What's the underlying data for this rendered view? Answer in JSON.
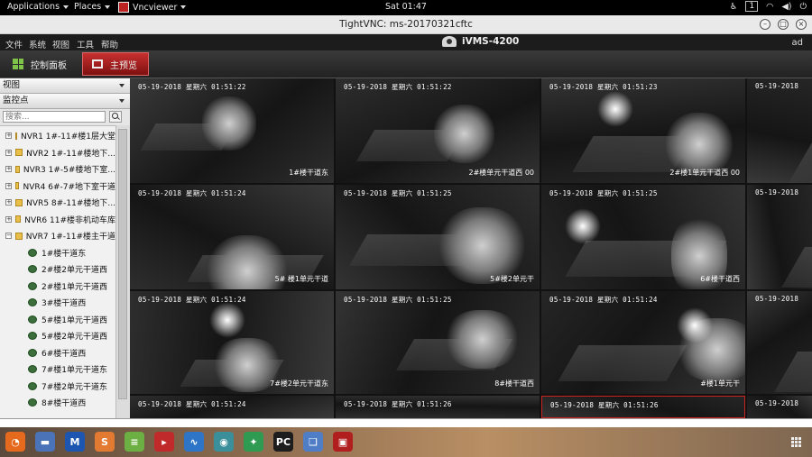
{
  "topbar": {
    "applications": "Applications",
    "places": "Places",
    "vncviewer": "Vncviewer",
    "clock": "Sat 01:47",
    "workspace": "1"
  },
  "vnc": {
    "title": "TightVNC: ms-20170321cftc"
  },
  "ivms": {
    "menu": [
      "文件",
      "系统",
      "视图",
      "工具",
      "帮助"
    ],
    "app_title": "iVMS-4200",
    "user": "ad",
    "tabs": {
      "control": "控制面板",
      "main": "主预览"
    }
  },
  "leftpanel": {
    "view_header": "视图",
    "monitor_header": "监控点",
    "search_placeholder": "搜索...",
    "nvrs": [
      "NVR1 1#-11#楼1层大堂",
      "NVR2 1#-11#楼地下...",
      "NVR3 1#-5#楼地下室...",
      "NVR4 6#-7#地下室干道",
      "NVR5 8#-11#楼地下...",
      "NVR6 11#楼非机动车库",
      "NVR7 1#-11#楼主干道"
    ],
    "cameras": [
      "1#楼干道东",
      "2#楼2单元干道西",
      "2#楼1单元干道西",
      "3#楼干道西",
      "5#楼1单元干道西",
      "5#楼2单元干道西",
      "6#楼干道西",
      "7#楼1单元干道东",
      "7#楼2单元干道东",
      "8#楼干道西"
    ]
  },
  "grid": {
    "cells": [
      {
        "ts": "05-19-2018 星期六 01:51:22",
        "label": "1#楼干道东"
      },
      {
        "ts": "05-19-2018 星期六 01:51:22",
        "label": "2#楼单元干道西 00"
      },
      {
        "ts": "05-19-2018 星期六 01:51:23",
        "label": "2#楼1单元干道西 00"
      },
      {
        "ts": "05-19-2018",
        "label": ""
      },
      {
        "ts": "05-19-2018 星期六 01:51:24",
        "label": "5# 楼1单元干道"
      },
      {
        "ts": "05-19-2018 星期六 01:51:25",
        "label": "5#楼2单元干"
      },
      {
        "ts": "05-19-2018 星期六 01:51:25",
        "label": "6#楼干道西"
      },
      {
        "ts": "05-19-2018",
        "label": ""
      },
      {
        "ts": "05-19-2018 星期六 01:51:24",
        "label": "7#楼2单元干道东"
      },
      {
        "ts": "05-19-2018 星期六 01:51:25",
        "label": "8#楼干道西"
      },
      {
        "ts": "05-19-2018 星期六 01:51:24",
        "label": "#楼1单元干"
      },
      {
        "ts": "05-19-2018",
        "label": ""
      },
      {
        "ts": "05-19-2018 星期六 01:51:24",
        "label": ""
      },
      {
        "ts": "05-19-2018 星期六 01:51:26",
        "label": ""
      },
      {
        "ts": "05-19-2018 星期六 01:51:26",
        "label": ""
      },
      {
        "ts": "05-19-2018",
        "label": ""
      }
    ]
  },
  "dock": [
    {
      "name": "firefox-icon",
      "color": "#e66a1e",
      "glyph": "◔"
    },
    {
      "name": "files-icon",
      "color": "#4a73b8",
      "glyph": "▬"
    },
    {
      "name": "malwarebytes-icon",
      "color": "#1c56b0",
      "glyph": "M"
    },
    {
      "name": "sublime-icon",
      "color": "#e27a32",
      "glyph": "S"
    },
    {
      "name": "notes-icon",
      "color": "#6cb043",
      "glyph": "≡"
    },
    {
      "name": "terminal-red-icon",
      "color": "#c12a2a",
      "glyph": "▸"
    },
    {
      "name": "monitor-icon",
      "color": "#2f75c7",
      "glyph": "∿"
    },
    {
      "name": "eye-icon",
      "color": "#3a8f9a",
      "glyph": "◉"
    },
    {
      "name": "recycle-icon",
      "color": "#2e9a52",
      "glyph": "✦"
    },
    {
      "name": "pycharm-icon",
      "color": "#1d1d1d",
      "glyph": "PC"
    },
    {
      "name": "virtualbox-icon",
      "color": "#4f7ec7",
      "glyph": "❑"
    },
    {
      "name": "vncviewer-icon",
      "color": "#b01e1e",
      "glyph": "▣"
    }
  ]
}
